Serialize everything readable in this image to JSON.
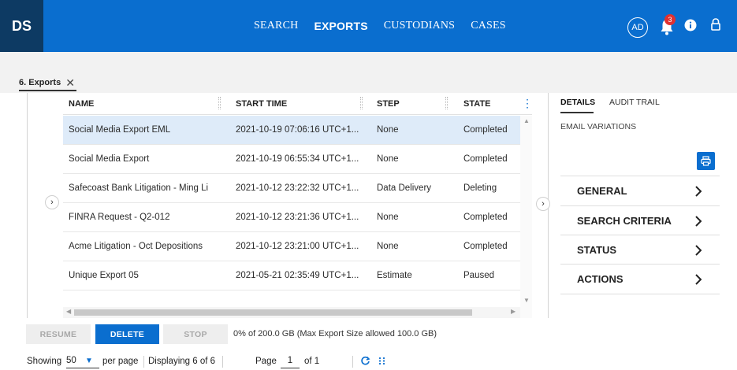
{
  "app": {
    "logo": "DS"
  },
  "nav": {
    "items": [
      "SEARCH",
      "EXPORTS",
      "CUSTODIANS",
      "CASES"
    ],
    "active": "EXPORTS"
  },
  "user": {
    "initials": "AD",
    "notification_count": "3"
  },
  "page_tab": {
    "label": "6. Exports"
  },
  "grid": {
    "columns": [
      "NAME",
      "START TIME",
      "STEP",
      "STATE"
    ],
    "rows": [
      {
        "name": "Social Media Export EML",
        "start": "2021-10-19 07:06:16 UTC+1...",
        "step": "None",
        "state": "Completed"
      },
      {
        "name": "Social Media Export",
        "start": "2021-10-19 06:55:34 UTC+1...",
        "step": "None",
        "state": "Completed"
      },
      {
        "name": "Safecoast Bank Litigation - Ming Li",
        "start": "2021-10-12 23:22:32 UTC+1...",
        "step": "Data Delivery",
        "state": "Deleting"
      },
      {
        "name": "FINRA Request - Q2-012",
        "start": "2021-10-12 23:21:36 UTC+1...",
        "step": "None",
        "state": "Completed"
      },
      {
        "name": "Acme Litigation - Oct Depositions",
        "start": "2021-10-12 23:21:00 UTC+1...",
        "step": "None",
        "state": "Completed"
      },
      {
        "name": "Unique Export 05",
        "start": "2021-05-21 02:35:49 UTC+1...",
        "step": "Estimate",
        "state": "Paused"
      }
    ]
  },
  "details": {
    "tabs": [
      "DETAILS",
      "AUDIT TRAIL"
    ],
    "subtitle": "EMAIL VARIATIONS",
    "sections": [
      "GENERAL",
      "SEARCH CRITERIA",
      "STATUS",
      "ACTIONS"
    ]
  },
  "actions": {
    "resume": "RESUME",
    "delete": "DELETE",
    "stop": "STOP",
    "size_info": "0% of 200.0 GB (Max Export Size allowed 100.0 GB)"
  },
  "pager": {
    "showing": "Showing",
    "per_page_value": "50",
    "per_page": "per page",
    "displaying": "Displaying 6 of 6",
    "page": "Page",
    "page_value": "1",
    "of": "of 1"
  },
  "colors": {
    "accent": "#0a6ecf",
    "logo_bg": "#0d3a63",
    "selected_row": "#deebf9",
    "badge": "#e03131"
  }
}
